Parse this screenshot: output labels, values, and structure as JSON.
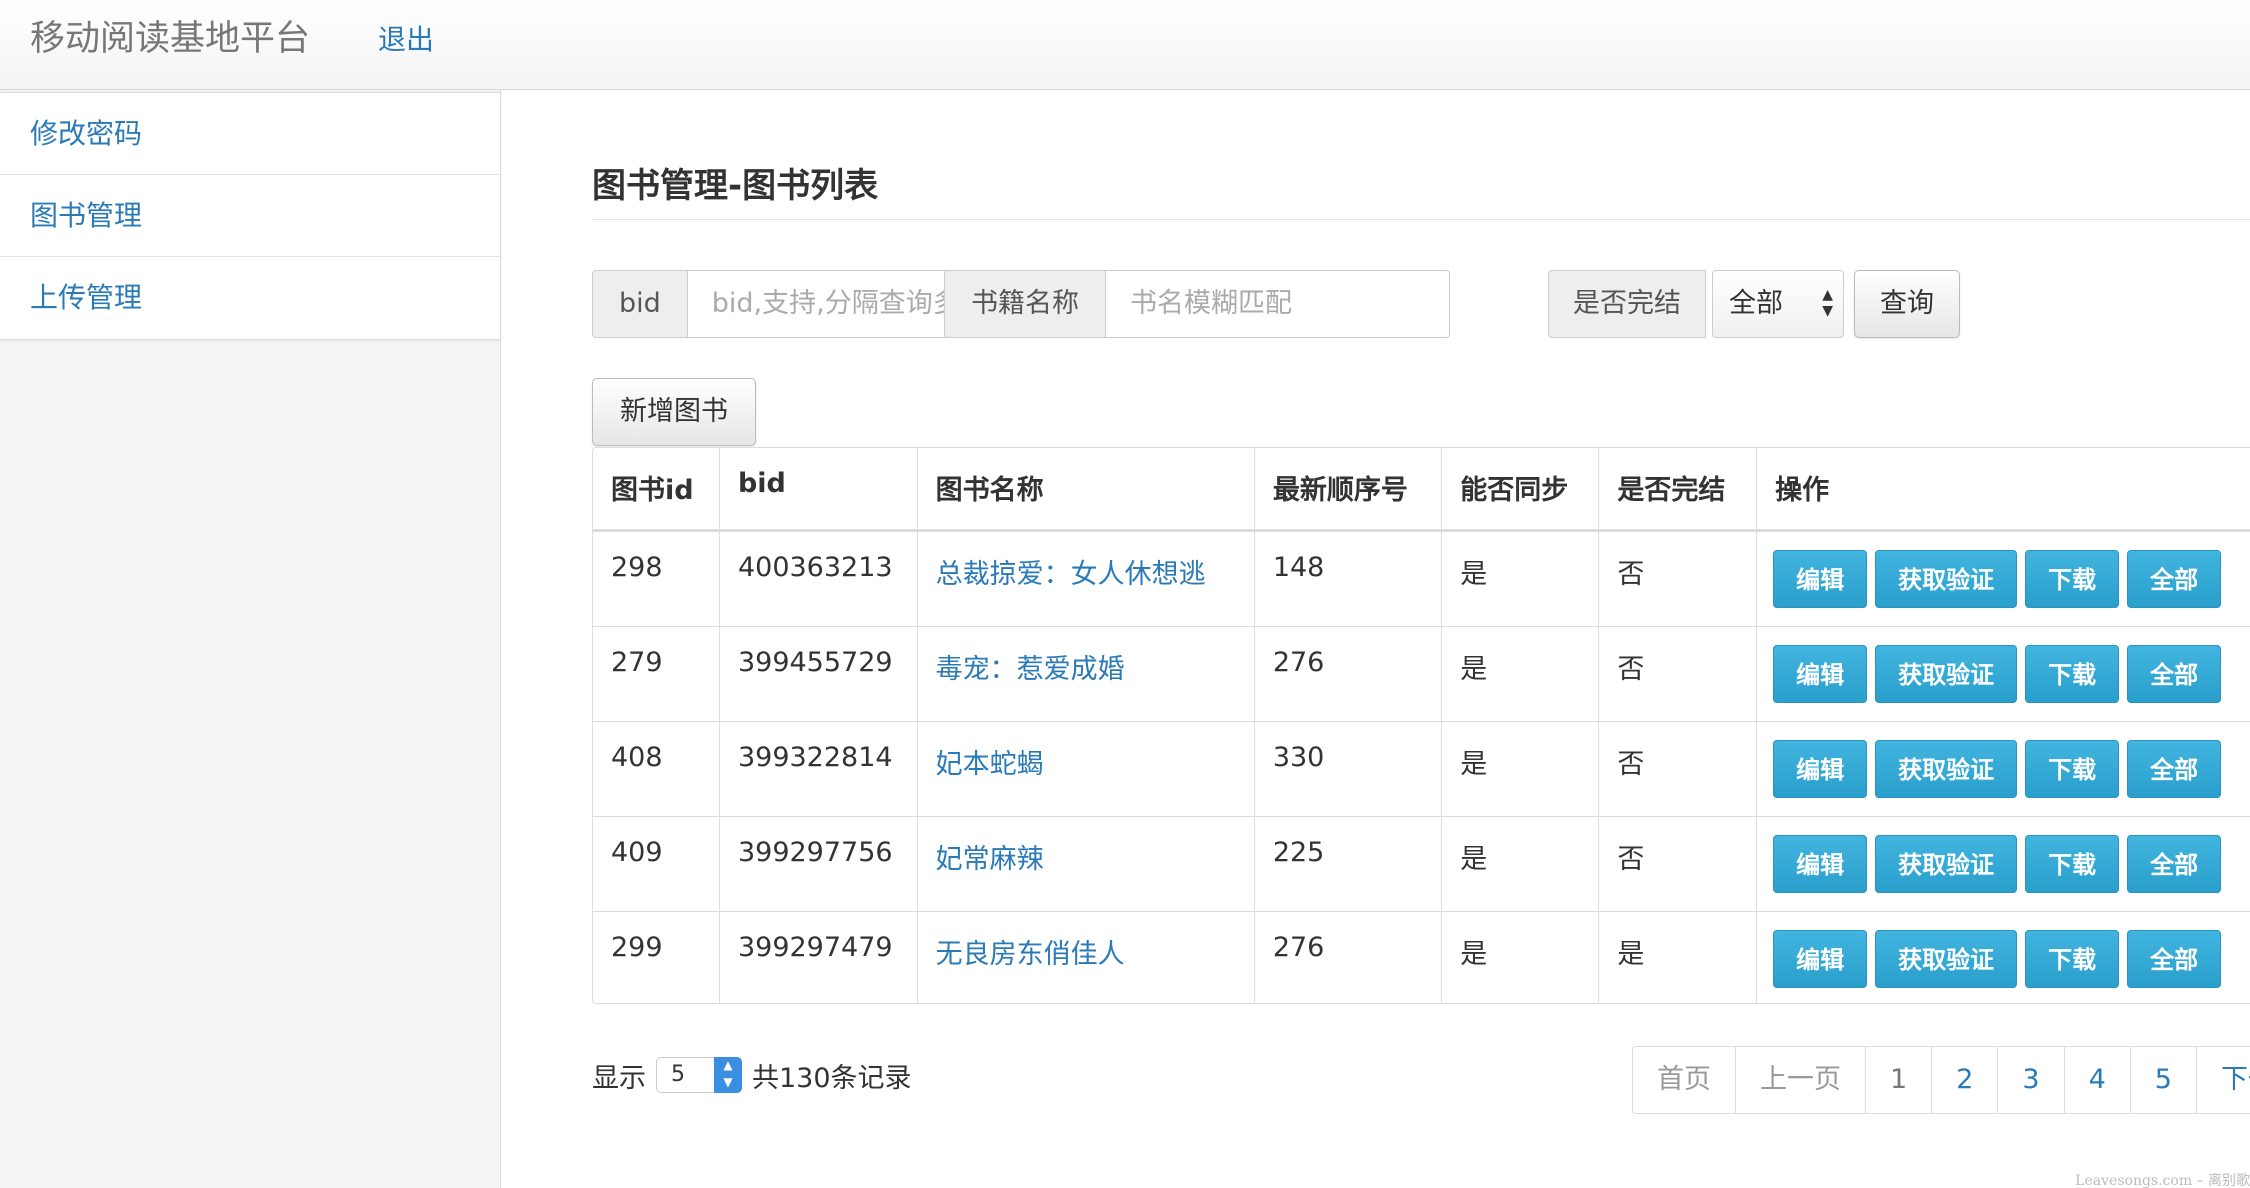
{
  "navbar": {
    "brand": "移动阅读基地平台",
    "logout": "退出"
  },
  "sidebar": {
    "items": [
      {
        "label": "修改密码"
      },
      {
        "label": "图书管理"
      },
      {
        "label": "上传管理"
      }
    ]
  },
  "page": {
    "title": "图书管理-图书列表"
  },
  "filters": {
    "bid_label": "bid",
    "bid_placeholder": "bid,支持,分隔查询多个",
    "name_label": "书籍名称",
    "name_placeholder": "书名模糊匹配",
    "finished_label": "是否完结",
    "finished_value": "全部",
    "search_button": "查询"
  },
  "add_button": "新增图书",
  "table": {
    "headers": [
      "图书id",
      "bid",
      "图书名称",
      "最新顺序号",
      "能否同步",
      "是否完结",
      "操作"
    ],
    "rows": [
      {
        "id": "298",
        "bid": "400363213",
        "name": "总裁掠爱：女人休想逃",
        "seq": "148",
        "sync": "是",
        "finished": "否"
      },
      {
        "id": "279",
        "bid": "399455729",
        "name": "毒宠：惹爱成婚",
        "seq": "276",
        "sync": "是",
        "finished": "否"
      },
      {
        "id": "408",
        "bid": "399322814",
        "name": "妃本蛇蝎",
        "seq": "330",
        "sync": "是",
        "finished": "否"
      },
      {
        "id": "409",
        "bid": "399297756",
        "name": "妃常麻辣",
        "seq": "225",
        "sync": "是",
        "finished": "否"
      },
      {
        "id": "299",
        "bid": "399297479",
        "name": "无良房东俏佳人",
        "seq": "276",
        "sync": "是",
        "finished": "是"
      }
    ],
    "actions": {
      "edit": "编辑",
      "verify": "获取验证",
      "download": "下载",
      "all": "全部"
    }
  },
  "footer": {
    "show_label": "显示",
    "page_size": "5",
    "total": "共130条记录",
    "pagination": {
      "first": "首页",
      "prev": "上一页",
      "pages": [
        "1",
        "2",
        "3",
        "4",
        "5"
      ],
      "next": "下一页"
    }
  },
  "watermark": "Leavesongs.com – 离别歌"
}
